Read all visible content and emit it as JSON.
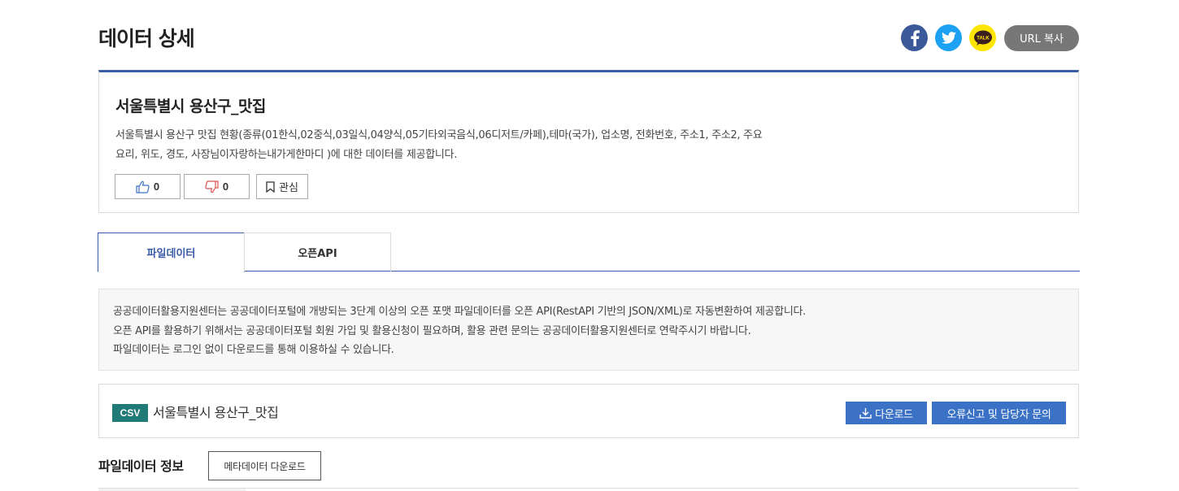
{
  "page_title": "데이터 상세",
  "share": {
    "facebook_icon": "facebook-icon",
    "twitter_icon": "twitter-icon",
    "kakao_icon": "kakaotalk-icon",
    "kakao_label": "TALK",
    "url_copy_label": "URL 복사"
  },
  "dataset": {
    "title": "서울특별시 용산구_맛집",
    "description_line1": "서울특별시 용산구 맛집 현황(종류(01한식,02중식,03일식,04양식,05기타외국음식,06디저트/카페),테마(국가), 업소명, 전화번호, 주소1, 주소2, 주요",
    "description_line2": "요리, 위도, 경도, 사장님이자랑하는내가게한마디 )에 대한 데이터를 제공합니다.",
    "like_count": "0",
    "dislike_count": "0",
    "favorite_label": "관심"
  },
  "tabs": [
    {
      "label": "파일데이터",
      "active": true
    },
    {
      "label": "오픈API",
      "active": false
    }
  ],
  "notice": {
    "line1": "공공데이터활용지원센터는 공공데이터포털에 개방되는 3단계 이상의 오픈 포맷 파일데이터를 오픈 API(RestAPI 기반의 JSON/XML)로 자동변환하여 제공합니다.",
    "line2": "오픈 API를 활용하기 위해서는 공공데이터포털 회원 가입 및 활용신청이 필요하며, 활용 관련 문의는 공공데이터활용지원센터로 연락주시기 바랍니다.",
    "line3": "파일데이터는 로그인 없이 다운로드를 통해 이용하실 수 있습니다."
  },
  "file": {
    "format_badge": "CSV",
    "name": "서울특별시 용산구_맛집",
    "download_label": "다운로드",
    "report_label": "오류신고 및 담당자 문의"
  },
  "file_info": {
    "section_title": "파일데이터 정보",
    "metadata_download_label": "메타데이터 다운로드"
  },
  "colors": {
    "accent": "#3b5ca8",
    "button_blue": "#3b72c5",
    "csv_badge": "#1f7a78",
    "facebook": "#3b5998",
    "twitter": "#1da1f2",
    "kakao": "#fee500"
  }
}
